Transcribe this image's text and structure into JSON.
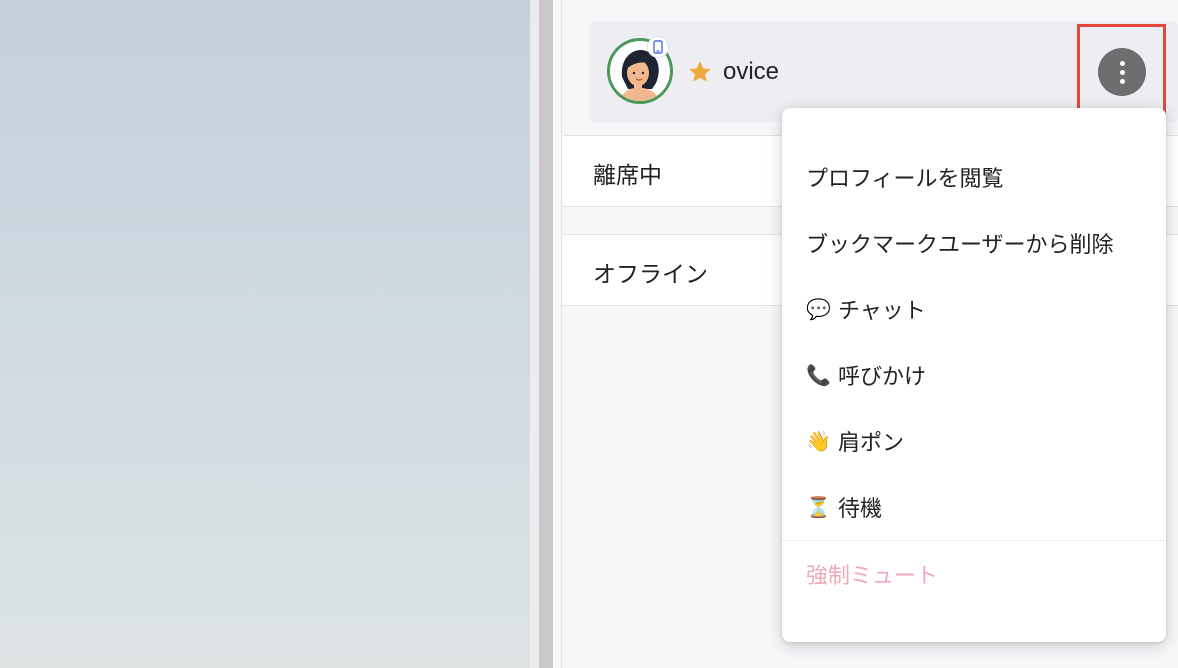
{
  "user": {
    "name": "ovice",
    "favorite": true,
    "status_ring_color": "#4b9a5c",
    "device_icon": "mobile-phone-icon"
  },
  "sections": {
    "away": "離席中",
    "offline": "オフライン"
  },
  "menu": {
    "items": [
      {
        "label": "プロフィールを閲覧",
        "icon": ""
      },
      {
        "label": "ブックマークユーザーから削除",
        "icon": ""
      },
      {
        "label": "チャット",
        "icon": "💬"
      },
      {
        "label": "呼びかけ",
        "icon": "📞"
      },
      {
        "label": "肩ポン",
        "icon": "👋"
      },
      {
        "label": "待機",
        "icon": "⏳"
      }
    ],
    "danger_item": {
      "label": "強制ミュート"
    }
  },
  "colors": {
    "highlight": "#e5463a",
    "kebab_bg": "#6e6e70",
    "star": "#f0a93b",
    "danger_text": "#f2a7b9"
  }
}
